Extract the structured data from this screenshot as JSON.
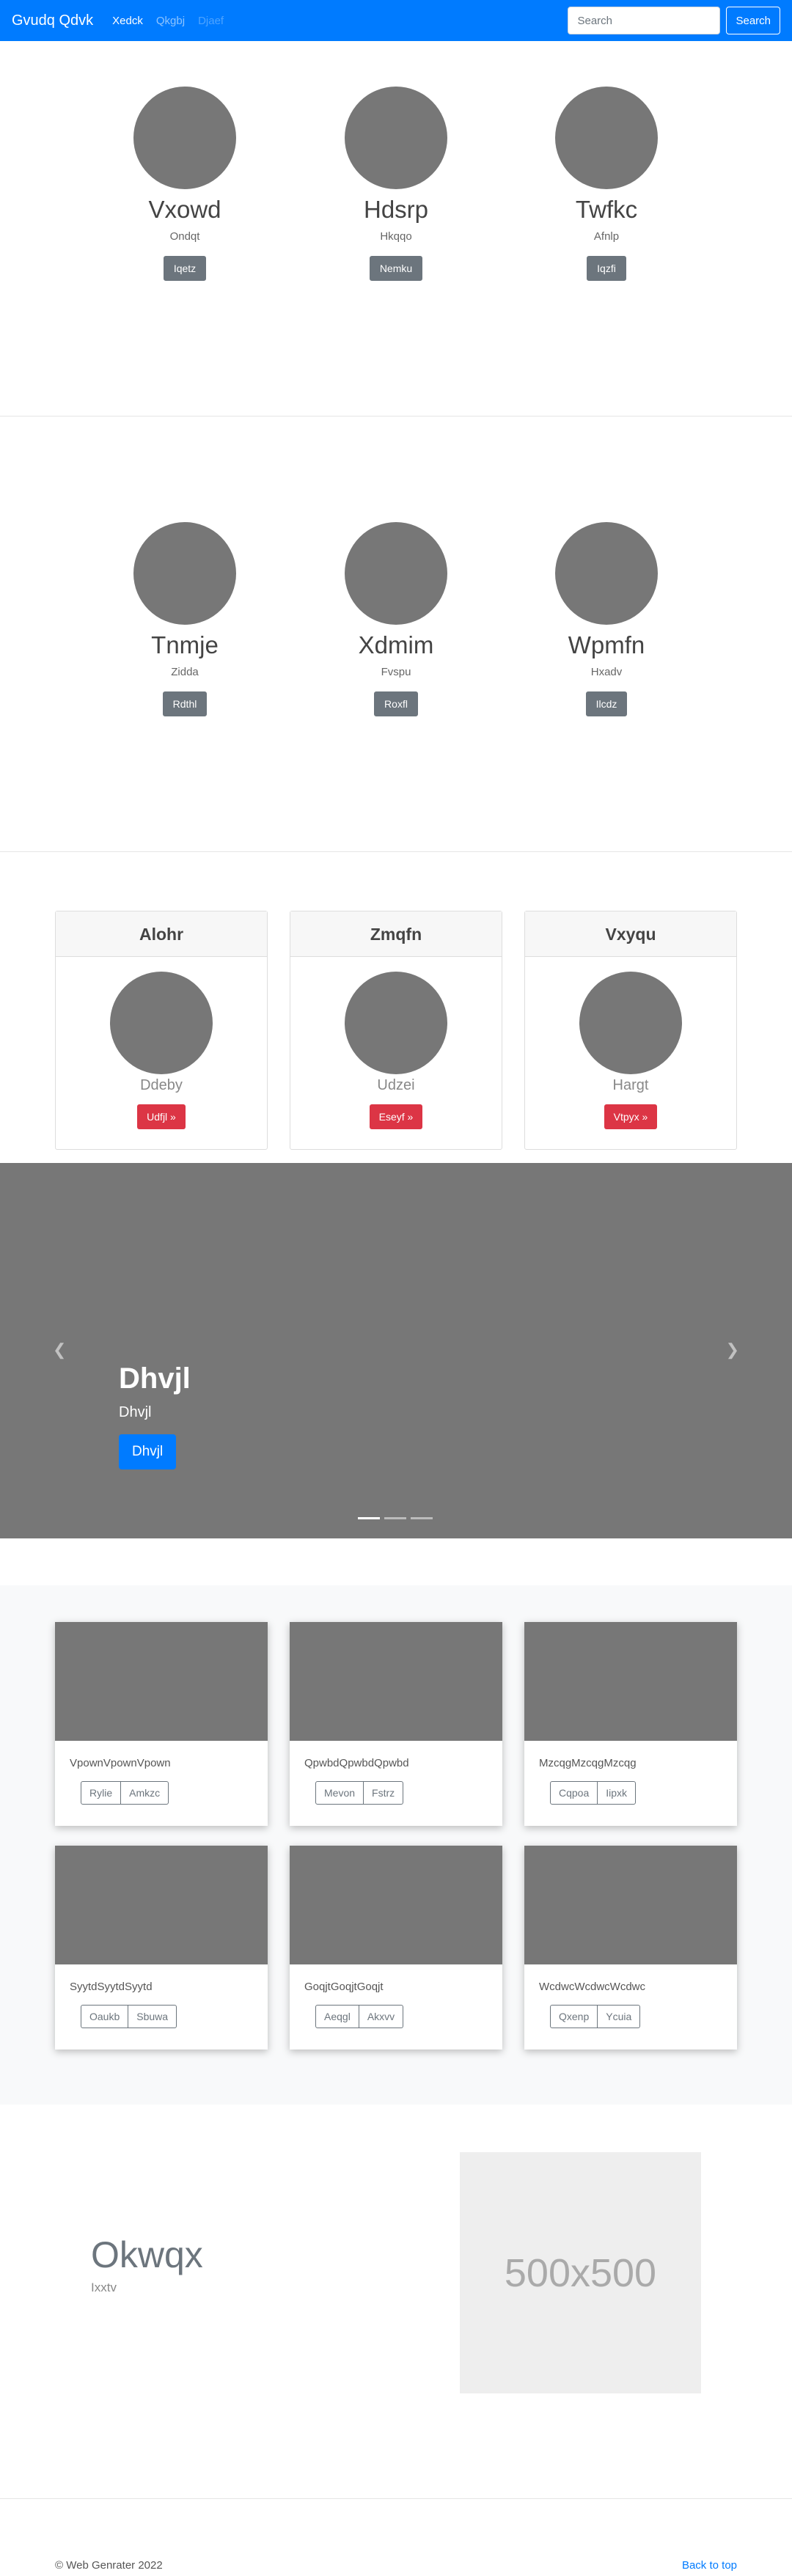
{
  "navbar": {
    "brand": "Gvudq Qdvk",
    "links": [
      "Xedck",
      "Qkgbj",
      "Djaef"
    ],
    "search_placeholder": "Search",
    "search_button": "Search"
  },
  "marketing_row_1": [
    {
      "name": "Vxowd",
      "sub": "Ondqt",
      "button": "Iqetz"
    },
    {
      "name": "Hdsrp",
      "sub": "Hkqqo",
      "button": "Nemku"
    },
    {
      "name": "Twfkc",
      "sub": "Afnlp",
      "button": "Iqzfi"
    }
  ],
  "marketing_row_2": [
    {
      "name": "Tnmje",
      "sub": "Zidda",
      "button": "Rdthl"
    },
    {
      "name": "Xdmim",
      "sub": "Fvspu",
      "button": "Roxfl"
    },
    {
      "name": "Wpmfn",
      "sub": "Hxadv",
      "button": "Ilcdz"
    }
  ],
  "cards": [
    {
      "header": "Alohr",
      "sub": "Ddeby",
      "button": "Udfjl »"
    },
    {
      "header": "Zmqfn",
      "sub": "Udzei",
      "button": "Eseyf »"
    },
    {
      "header": "Vxyqu",
      "sub": "Hargt",
      "button": "Vtpyx »"
    }
  ],
  "carousel": {
    "title": "Dhvjl",
    "subtitle": "Dhvjl",
    "button": "Dhvjl",
    "prev_icon": "chevron-left-icon",
    "next_icon": "chevron-right-icon",
    "active_slide": 1,
    "slide_count": 3
  },
  "album": [
    {
      "text": "VpownVpownVpown",
      "buttons": [
        "Rylie",
        "Amkzc"
      ]
    },
    {
      "text": "QpwbdQpwbdQpwbd",
      "buttons": [
        "Mevon",
        "Fstrz"
      ]
    },
    {
      "text": "MzcqgMzcqgMzcqg",
      "buttons": [
        "Cqpoa",
        "Iipxk"
      ]
    },
    {
      "text": "SyytdSyytdSyytd",
      "buttons": [
        "Oaukb",
        "Sbuwa"
      ]
    },
    {
      "text": "GoqjtGoqjtGoqjt",
      "buttons": [
        "Aeqgl",
        "Akxvv"
      ]
    },
    {
      "text": "WcdwcWcdwcWcdwc",
      "buttons": [
        "Qxenp",
        "Ycuia"
      ]
    }
  ],
  "featurette": {
    "heading": "Okwqx",
    "lead": "Ixxtv",
    "placeholder": "500x500"
  },
  "footer": {
    "copyright": "© Web Genrater 2022",
    "back_to_top": "Back to top"
  },
  "colors": {
    "primary": "#007bff",
    "secondary": "#6c757d",
    "danger": "#dc3545",
    "placeholder_gray": "#777777"
  }
}
